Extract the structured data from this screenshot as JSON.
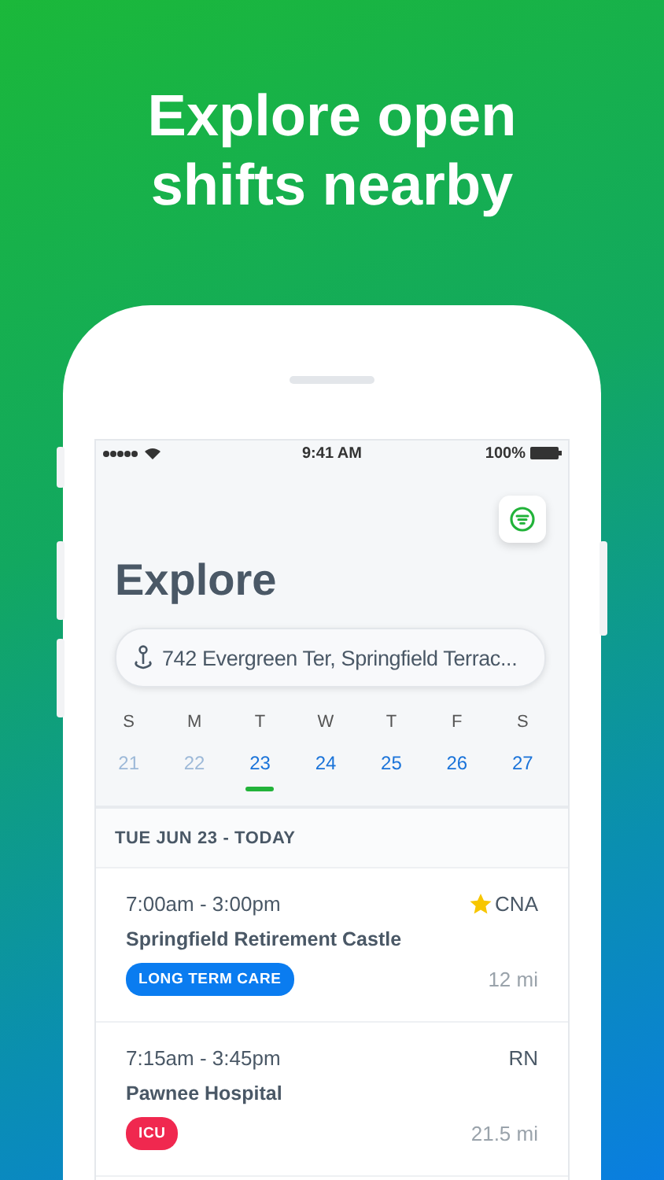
{
  "headline": "Explore open shifts nearby",
  "status_bar": {
    "time": "9:41 AM",
    "battery": "100%"
  },
  "title": "Explore",
  "search": {
    "value": "742 Evergreen Ter, Springfield Terrac..."
  },
  "days": [
    {
      "letter": "S",
      "date": "21",
      "past": true,
      "selected": false
    },
    {
      "letter": "M",
      "date": "22",
      "past": true,
      "selected": false
    },
    {
      "letter": "T",
      "date": "23",
      "past": false,
      "selected": true
    },
    {
      "letter": "W",
      "date": "24",
      "past": false,
      "selected": false
    },
    {
      "letter": "T",
      "date": "25",
      "past": false,
      "selected": false
    },
    {
      "letter": "F",
      "date": "26",
      "past": false,
      "selected": false
    },
    {
      "letter": "S",
      "date": "27",
      "past": false,
      "selected": false
    }
  ],
  "section_header": "TUE JUN 23 - TODAY",
  "shifts": [
    {
      "time": "7:00am - 3:00pm",
      "role": "CNA",
      "starred": true,
      "facility": "Springfield Retirement Castle",
      "tag": "LONG TERM CARE",
      "color": "#0a7cf0",
      "distance": "12 mi"
    },
    {
      "time": "7:15am - 3:45pm",
      "role": "RN",
      "starred": false,
      "facility": "Pawnee Hospital",
      "tag": "ICU",
      "color": "#f0284f",
      "distance": "21.5 mi"
    }
  ]
}
